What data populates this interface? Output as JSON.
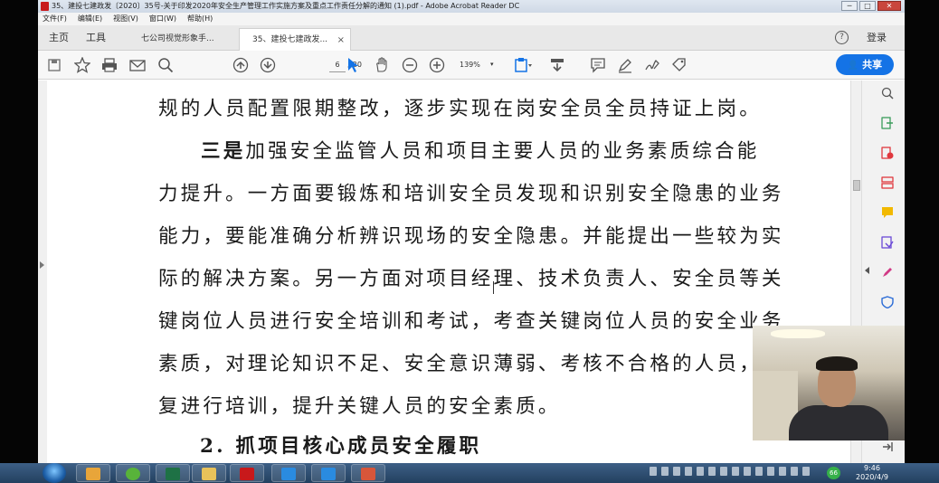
{
  "window": {
    "title": "35、建投七建政发〔2020〕35号-关于印发2020年安全生产管理工作实施方案及重点工作责任分解的通知 (1).pdf - Adobe Acrobat Reader DC",
    "minimize": "─",
    "maximize": "□",
    "close": "✕"
  },
  "menu": [
    "文件(F)",
    "编辑(E)",
    "视图(V)",
    "窗口(W)",
    "帮助(H)"
  ],
  "nav": {
    "home": "主页",
    "tools": "工具",
    "help": "?",
    "login": "登录"
  },
  "tabs": [
    {
      "label": "七公司视觉形象手...",
      "active": false
    },
    {
      "label": "35、建投七建政发...",
      "active": true,
      "close": "×"
    }
  ],
  "toolbar": {
    "page_current": "6",
    "page_total": "/ 20",
    "zoom": "139%",
    "share_label": "共享"
  },
  "document": {
    "lines": [
      "规的人员配置限期整改，逐步实现在岗安全员全员持证上岗。",
      "加强安全监管人员和项目主要人员的业务素质综合能",
      "力提升。一方面要锻炼和培训安全员发现和识别安全隐患的业务",
      "能力，要能准确分析辨识现场的安全隐患。并能提出一些较为实",
      "际的解决方案。另一方面对项目经理、技术负责人、安全员等关",
      "键岗位人员进行安全培训和考试，考查关键岗位人员的安全业务",
      "素质，对理论知识不足、安全意识薄弱、考核不合格的人员，反",
      "复进行培训，提升关键人员的安全素质。",
      "2.  抓项目核心成员安全履职"
    ],
    "bold_prefix": "三是"
  },
  "right_panel_icons": [
    "zoom-icon",
    "export-pdf-icon",
    "create-pdf-icon",
    "organize-pages-icon",
    "comment-icon",
    "send-sign-icon",
    "fill-sign-icon",
    "protect-icon"
  ],
  "taskbar": {
    "clock_time": "9:46",
    "clock_date": "2020/4/9",
    "tray_badge": "66"
  },
  "colors": {
    "accent": "#1473e6",
    "pdf_red": "#c8191b"
  }
}
